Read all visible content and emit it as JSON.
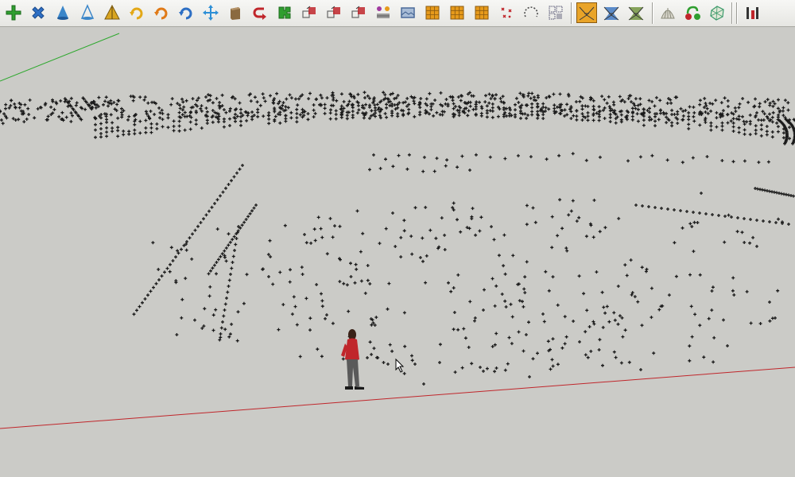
{
  "app": {
    "toolbar": {
      "buttons": [
        {
          "name": "add-point-button",
          "icon": "add-cross-icon",
          "color": "#2f9e2f",
          "active": false
        },
        {
          "name": "delete-point-button",
          "icon": "delete-cross-icon",
          "color": "#2d6fc4",
          "active": false
        },
        {
          "name": "cone-tool-button",
          "icon": "cone-icon",
          "color": "#3b86c9",
          "active": false
        },
        {
          "name": "cone-outline-tool-button",
          "icon": "cone-outline-icon",
          "color": "#3b86c9",
          "active": false
        },
        {
          "name": "triangle-tool-button",
          "icon": "triangle-icon",
          "color": "#d9a521",
          "active": false
        },
        {
          "name": "rotate-yellow-button",
          "icon": "rotate-arrow-icon",
          "color": "#e3a817",
          "active": false
        },
        {
          "name": "rotate-orange-button",
          "icon": "rotate-arrow-icon",
          "color": "#e07a17",
          "active": false
        },
        {
          "name": "rotate-blue-button",
          "icon": "rotate-arrow-icon",
          "color": "#2d6fc4",
          "active": false
        },
        {
          "name": "move-tool-button",
          "icon": "move-arrows-icon",
          "color": "#2d8fd6",
          "active": false
        },
        {
          "name": "box-tool-button",
          "icon": "box-icon",
          "color": "#8a6a3f",
          "active": false
        },
        {
          "name": "undo-curve-button",
          "icon": "u-turn-icon",
          "color": "#c0262b",
          "active": false
        },
        {
          "name": "group-tool-button",
          "icon": "puzzle-icon",
          "color": "#2f9e2f",
          "active": false
        },
        {
          "name": "transform-1-button",
          "icon": "transform-icon",
          "color": "#c0262b",
          "active": false
        },
        {
          "name": "transform-2-button",
          "icon": "transform-icon",
          "color": "#c0262b",
          "active": false
        },
        {
          "name": "transform-3-button",
          "icon": "transform-icon",
          "color": "#c0262b",
          "active": false
        },
        {
          "name": "component-tool-button",
          "icon": "component-grid-icon",
          "color": "#a13aa0",
          "active": false
        },
        {
          "name": "image-tool-button",
          "icon": "image-frame-icon",
          "color": "#4a6a9a",
          "active": false
        },
        {
          "name": "grid-orange-1-button",
          "icon": "grid-icon",
          "color": "#e69a1b",
          "active": false
        },
        {
          "name": "grid-orange-2-button",
          "icon": "grid-icon",
          "color": "#e69a1b",
          "active": false
        },
        {
          "name": "grid-orange-3-button",
          "icon": "grid-icon",
          "color": "#e69a1b",
          "active": false
        },
        {
          "name": "scatter-points-button",
          "icon": "scatter-points-icon",
          "color": "#c0262b",
          "active": false
        },
        {
          "name": "dashed-arc-button",
          "icon": "dashed-arc-icon",
          "color": "#4a4a4a",
          "active": false
        },
        {
          "name": "dotted-grid-button",
          "icon": "dotted-grid-icon",
          "color": "#4a4a6a",
          "active": false
        },
        {
          "name": "terrain-mesh-1-button",
          "icon": "terrain-mesh-icon",
          "color": "#e9a428",
          "active": true
        },
        {
          "name": "terrain-mesh-2-button",
          "icon": "terrain-mesh-icon",
          "color": "#4a7fc4",
          "active": false
        },
        {
          "name": "terrain-mesh-3-button",
          "icon": "terrain-mesh-icon",
          "color": "#7a9a4a",
          "active": false
        },
        {
          "name": "shell-tool-button",
          "icon": "shell-icon",
          "color": "#8a8a7a",
          "active": false
        },
        {
          "name": "pipe-tool-button",
          "icon": "pipe-icon",
          "color": "#2f9e2f",
          "active": false
        },
        {
          "name": "mesh-shape-button",
          "icon": "mesh-shape-icon",
          "color": "#3b9a6a",
          "active": false
        },
        {
          "name": "bar-tool-button",
          "icon": "bar-icon",
          "color": "#c0262b",
          "active": false
        }
      ]
    },
    "viewport": {
      "background": "#cbcbc7",
      "green_axis_color": "#2ea82e",
      "red_axis_color": "#c0262b",
      "point_color": "#1a1a1a",
      "figure": {
        "jacket_color": "#c0262b",
        "pants_color": "#5a5a5a"
      }
    }
  }
}
